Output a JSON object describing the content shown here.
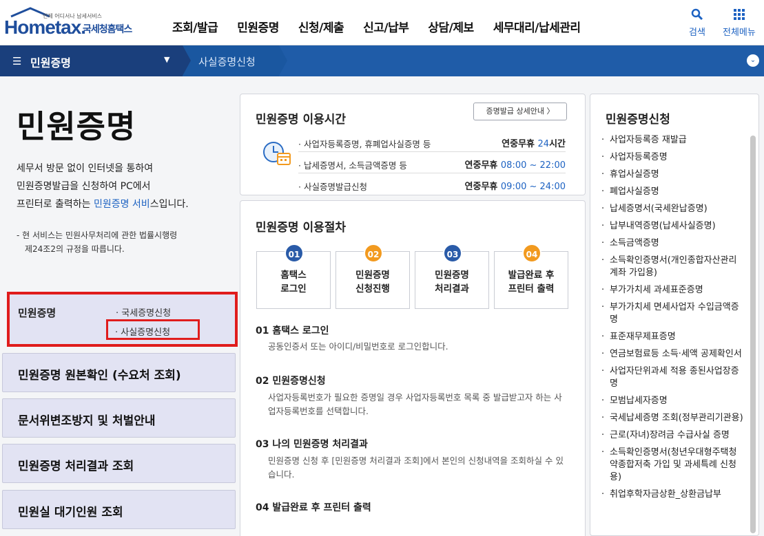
{
  "header": {
    "logo_sub": "언제 어디서나 납세서비스",
    "logo_main": "Hometax.",
    "logo_ko": "국세청홈택스",
    "gnb": [
      "조회/발급",
      "민원증명",
      "신청/제출",
      "신고/납부",
      "상담/제보",
      "세무대리/납세관리"
    ],
    "search_label": "검색",
    "allmenu_label": "전체메뉴"
  },
  "navbar": {
    "title": "민원증명",
    "sub": "사실증명신청"
  },
  "left": {
    "page_title": "민원증명",
    "intro_line1": "세무서 방문 없이 인터넷을 통하여",
    "intro_line2": "민원증명발급을 신청하여 PC에서",
    "intro_line3_pre": "프린터로 출력하는 ",
    "intro_line3_hl": "민원증명 서비",
    "intro_line3_post": "스입니다.",
    "note_line1": "- 현 서비스는 민원사무처리에 관한 법률시행령",
    "note_line2": "제24조2의 규정을 따릅니다.",
    "active_menu": {
      "title": "민원증명",
      "sub1": "· 국세증명신청",
      "sub2": "· 사실증명신청"
    },
    "menu": [
      "민원증명 원본확인 (수요처 조회)",
      "문서위변조방지 및 처벌안내",
      "민원증명 처리결과 조회",
      "민원실 대기인원 조회"
    ]
  },
  "hours": {
    "title": "민원증명 이용시간",
    "detail_btn": "증명발급 상세안내 〉",
    "rows": [
      {
        "label": "· 사업자등록증명, 휴폐업사실증명 등",
        "prefix": "연중무휴 ",
        "num": "24",
        "suffix": "시간"
      },
      {
        "label": "· 납세증명서, 소득금액증명 등",
        "prefix": "연중무휴 ",
        "num": "08:00 ~ 22:00",
        "suffix": ""
      },
      {
        "label": "· 사실증명발급신청",
        "prefix": "연중무휴 ",
        "num": "09:00 ~ 24:00",
        "suffix": ""
      }
    ]
  },
  "procedure": {
    "title": "민원증명 이용절차",
    "steps": [
      {
        "num": "01",
        "line1": "홈택스",
        "line2": "로그인",
        "color": "#2a5ba8"
      },
      {
        "num": "02",
        "line1": "민원증명",
        "line2": "신청진행",
        "color": "#f29a1f"
      },
      {
        "num": "03",
        "line1": "민원증명",
        "line2": "처리결과",
        "color": "#2a5ba8"
      },
      {
        "num": "04",
        "line1": "발급완료 후",
        "line2": "프린터 출력",
        "color": "#f29a1f"
      }
    ],
    "items": [
      {
        "heading": "01 홈택스 로그인",
        "desc": "공동인증서 또는 아이디/비밀번호로 로그인합니다."
      },
      {
        "heading": "02 민원증명신청",
        "desc": "사업자등록번호가 필요한 증명일 경우 사업자등록번호 목록 중 발급받고자 하는 사업자등록번호를 선택합니다."
      },
      {
        "heading": "03 나의 민원증명 처리결과",
        "desc": "민원증명 신청 후 [민원증명 처리결과 조회]에서 본인의 신청내역을 조회하실 수 있습니다."
      },
      {
        "heading": "04 발급완료 후 프린터 출력",
        "desc": ""
      }
    ]
  },
  "right": {
    "title": "민원증명신청",
    "items": [
      "사업자등록증 재발급",
      "사업자등록증명",
      "휴업사실증명",
      "폐업사실증명",
      "납세증명서(국세완납증명)",
      "납부내역증명(납세사실증명)",
      "소득금액증명",
      "소득확인증명서(개인종합자산관리계좌 가입용)",
      "부가가치세 과세표준증명",
      "부가가치세 면세사업자 수입금액증명",
      "표준재무제표증명",
      "연금보험료등 소득·세액 공제확인서",
      "사업자단위과세 적용 종된사업장증명",
      "모범납세자증명",
      "국세납세증명 조회(정부관리기관용)",
      "근로(자녀)장려금 수급사실 증명",
      "소득확인증명서(청년우대형주택청약종합저축 가입 및 과세특례 신청용)",
      "취업후학자금상환_상환금납부"
    ]
  }
}
